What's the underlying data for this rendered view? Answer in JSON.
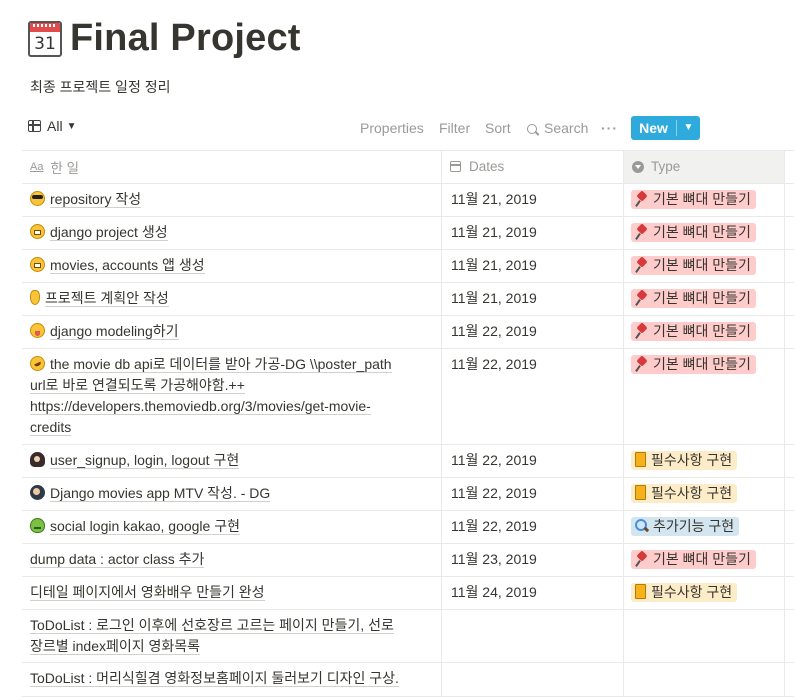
{
  "page": {
    "icon_date": "31",
    "title": "Final Project",
    "subtitle": "최종 프로젝트 일정 정리"
  },
  "toolbar": {
    "view_label": "All",
    "properties": "Properties",
    "filter": "Filter",
    "sort": "Sort",
    "search": "Search",
    "more": "···",
    "new_label": "New"
  },
  "columns": {
    "name": "한 일",
    "name_icon_text": "Aa",
    "dates": "Dates",
    "type": "Type"
  },
  "rows": [
    {
      "emoji": "sunglasses-emoji",
      "title": "repository 작성",
      "date": "11월 21, 2019",
      "type": "기본 뼈대 만들기"
    },
    {
      "emoji": "grimacing-emoji",
      "title": "django project 생성",
      "date": "11월 21, 2019",
      "type": "기본 뼈대 만들기"
    },
    {
      "emoji": "grimacing-emoji",
      "title": "movies, accounts 앱 생성",
      "date": "11월 21, 2019",
      "type": "기본 뼈대 만들기"
    },
    {
      "emoji": "ok-hand-emoji",
      "title": "프로젝트 계획안 작성",
      "date": "11월 21, 2019",
      "type": "기본 뼈대 만들기"
    },
    {
      "emoji": "tongue-emoji",
      "title": "django modeling하기",
      "date": "11월 22, 2019",
      "type": "기본 뼈대 만들기"
    },
    {
      "emoji": "rofl-emoji",
      "title_lines": [
        "the movie db api로 데이터를 받아 가공-DG \\\\poster_path",
        "url로 바로 연결되도록 가공해야함.++",
        "https://developers.themoviedb.org/3/movies/get-movie-",
        "credits"
      ],
      "date": "11월 22, 2019",
      "type": "기본 뼈대 만들기"
    },
    {
      "emoji": "person-emoji",
      "title": "user_signup, login, logout 구현",
      "date": "11월 22, 2019",
      "type": "필수사항 구현"
    },
    {
      "emoji": "diver-emoji",
      "title": "Django movies app MTV 작성. - DG",
      "date": "11월 22, 2019",
      "type": "필수사항 구현"
    },
    {
      "emoji": "frog-emoji",
      "title": "social login kakao, google 구현",
      "date": "11월 22, 2019",
      "type": "추가기능 구현"
    },
    {
      "title": "dump data : actor class 추가",
      "date": "11월 23, 2019",
      "type": "기본 뼈대 만들기"
    },
    {
      "title": "디테일 페이지에서 영화배우 만들기 완성",
      "date": "11월 24, 2019",
      "type": "필수사항 구현"
    },
    {
      "title_lines": [
        "ToDoList : 로그인 이후에 선호장르 고르는 페이지 만들기, 선로",
        "장르별 index페이지 영화목록"
      ],
      "date": "",
      "type": ""
    },
    {
      "title": "ToDoList : 머리식힐겸 영화정보홈페이지 둘러보기 디자인 구상.",
      "date": "",
      "type": ""
    }
  ],
  "type_styles": {
    "기본 뼈대 만들기": {
      "color": "#ffcccc",
      "icon": "pushpin-icon"
    },
    "필수사항 구현": {
      "color": "#fdecc8",
      "icon": "book-icon"
    },
    "추가기능 구현": {
      "color": "#d3e5ef",
      "icon": "magnifier-icon"
    }
  }
}
